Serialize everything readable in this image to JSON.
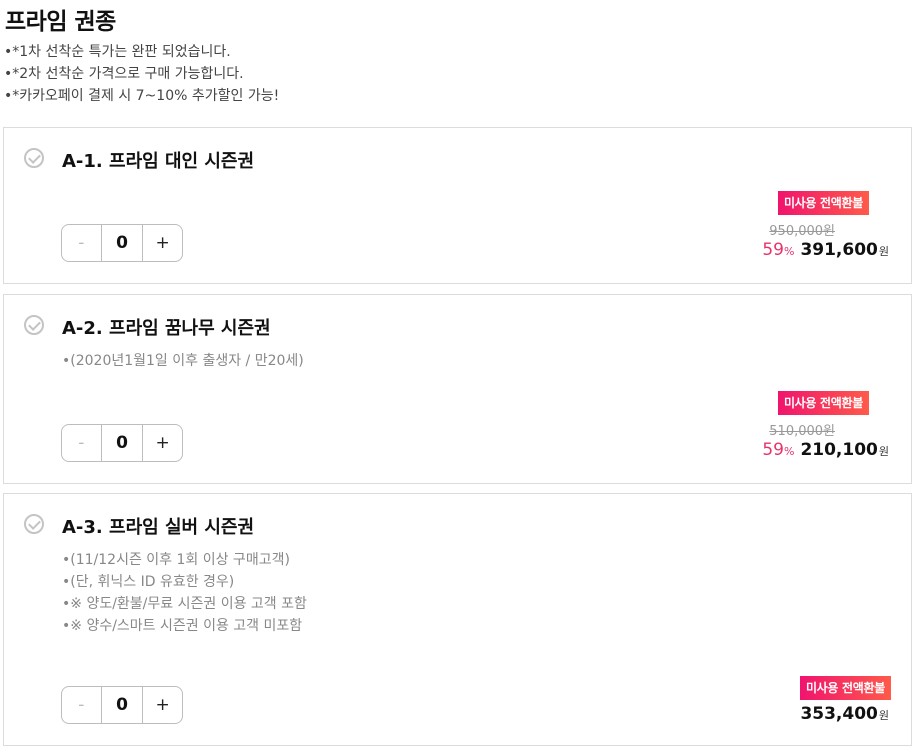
{
  "page": {
    "title": "프라임 권종",
    "notices": [
      "•*1차 선착순 특가는 완판 되었습니다.",
      "•*2차 선착순 가격으로 구매 가능합니다.",
      "•*카카오페이 결제 시 7~10% 추가할인 가능!"
    ]
  },
  "products": [
    {
      "title": "A-1. 프라임 대인 시즌권",
      "badge": "미사용 전액환불",
      "original_price": "950,000원",
      "discount": "59",
      "discount_unit": "%",
      "price": "391,600",
      "currency": "원",
      "quantity": "0",
      "minus_label": "-",
      "plus_label": "+"
    },
    {
      "title": "A-2. 프라임 꿈나무 시즌권",
      "notes": [
        "•(2020년1월1일 이후 출생자 / 만20세)"
      ],
      "badge": "미사용 전액환불",
      "original_price": "510,000원",
      "discount": "59",
      "discount_unit": "%",
      "price": "210,100",
      "currency": "원",
      "quantity": "0",
      "minus_label": "-",
      "plus_label": "+"
    },
    {
      "title": "A-3. 프라임 실버 시즌권",
      "notes": [
        "•(11/12시즌 이후 1회 이상 구매고객)",
        "•(단, 휘닉스 ID 유효한 경우)",
        "•※ 양도/환불/무료 시즌권 이용 고객 포함",
        "•※ 양수/스마트 시즌권 이용 고객 미포함"
      ],
      "badge": "미사용 전액환불",
      "price": "353,400",
      "currency": "원",
      "quantity": "0",
      "minus_label": "-",
      "plus_label": "+"
    }
  ],
  "colors": {
    "badge_start": "#f0146e",
    "badge_end": "#ff5a4a",
    "discount": "#e8336a",
    "border": "#dcdcdc"
  }
}
